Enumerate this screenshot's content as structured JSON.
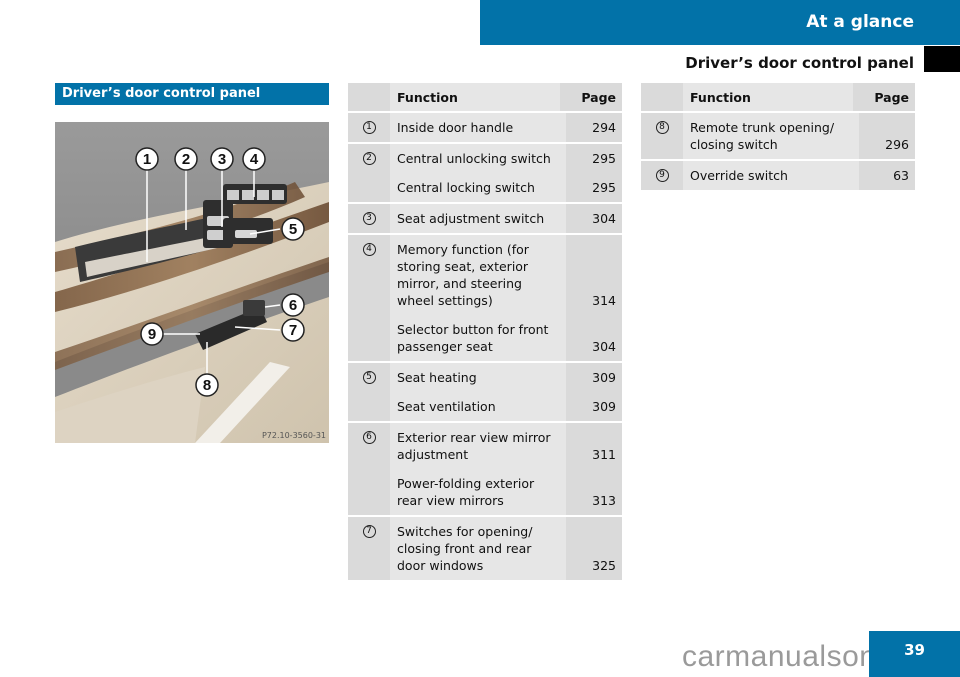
{
  "header": {
    "section_title": "At a glance",
    "page_subtitle": "Driver’s door control panel"
  },
  "section": {
    "heading": "Driver’s door control panel",
    "image_code": "P72.10-3560-31",
    "callouts": [
      "1",
      "2",
      "3",
      "4",
      "5",
      "6",
      "7",
      "8",
      "9"
    ]
  },
  "table_columns": {
    "function": "Function",
    "page": "Page"
  },
  "table_left": [
    {
      "num": "1",
      "entries": [
        {
          "function": "Inside door handle",
          "page": "294"
        }
      ]
    },
    {
      "num": "2",
      "entries": [
        {
          "function": "Central unlocking switch",
          "page": "295"
        },
        {
          "function": "Central locking switch",
          "page": "295"
        }
      ]
    },
    {
      "num": "3",
      "entries": [
        {
          "function": "Seat adjustment switch",
          "page": "304"
        }
      ]
    },
    {
      "num": "4",
      "entries": [
        {
          "function": "Memory function (for storing seat, exterior mirror, and steering wheel settings)",
          "page": "314"
        },
        {
          "function": "Selector button for front passenger seat",
          "page": "304"
        }
      ]
    },
    {
      "num": "5",
      "entries": [
        {
          "function": "Seat heating",
          "page": "309"
        },
        {
          "function": "Seat ventilation",
          "page": "309"
        }
      ]
    },
    {
      "num": "6",
      "entries": [
        {
          "function": "Exterior rear view mirror adjustment",
          "page": "311"
        },
        {
          "function": "Power-folding exterior rear view mirrors",
          "page": "313"
        }
      ]
    },
    {
      "num": "7",
      "entries": [
        {
          "function": "Switches for opening/ closing front and rear door windows",
          "page": "325"
        }
      ]
    }
  ],
  "table_right": [
    {
      "num": "8",
      "entries": [
        {
          "function": "Remote trunk opening/ closing switch",
          "page": "296"
        }
      ]
    },
    {
      "num": "9",
      "entries": [
        {
          "function": "Override switch",
          "page": "63"
        }
      ]
    }
  ],
  "footer": {
    "page_number": "39",
    "watermark": "carmanualsonline.info"
  },
  "colors": {
    "accent": "#0272a8"
  }
}
